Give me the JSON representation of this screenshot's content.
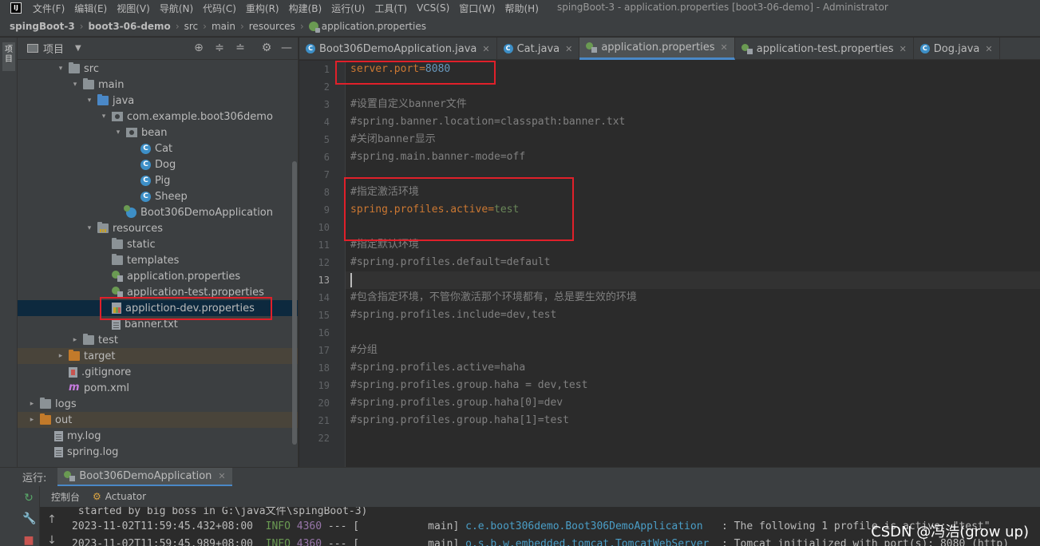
{
  "menu": {
    "logo": "IJ",
    "items": [
      "文件(F)",
      "编辑(E)",
      "视图(V)",
      "导航(N)",
      "代码(C)",
      "重构(R)",
      "构建(B)",
      "运行(U)",
      "工具(T)",
      "VCS(S)",
      "窗口(W)",
      "帮助(H)"
    ],
    "window_title": "spingBoot-3 - application.properties [boot3-06-demo] - Administrator"
  },
  "breadcrumb": [
    "spingBoot-3",
    "boot3-06-demo",
    "src",
    "main",
    "resources",
    "application.properties"
  ],
  "left_stripe": {
    "project_label": "项目"
  },
  "project_panel": {
    "title": "项目",
    "tools": [
      "⊕",
      "≑",
      "≐",
      "⚙",
      "—"
    ]
  },
  "tree": [
    {
      "label": "src",
      "indent": 3,
      "arrow": "▾",
      "icon": "folder"
    },
    {
      "label": "main",
      "indent": 4,
      "arrow": "▾",
      "icon": "folder"
    },
    {
      "label": "java",
      "indent": 5,
      "arrow": "▾",
      "icon": "folder blue"
    },
    {
      "label": "com.example.boot306demo",
      "indent": 6,
      "arrow": "▾",
      "icon": "package"
    },
    {
      "label": "bean",
      "indent": 7,
      "arrow": "▾",
      "icon": "package"
    },
    {
      "label": "Cat",
      "indent": 8,
      "arrow": "",
      "icon": "cls"
    },
    {
      "label": "Dog",
      "indent": 8,
      "arrow": "",
      "icon": "cls"
    },
    {
      "label": "Pig",
      "indent": 8,
      "arrow": "",
      "icon": "cls"
    },
    {
      "label": "Sheep",
      "indent": 8,
      "arrow": "",
      "icon": "cls"
    },
    {
      "label": "Boot306DemoApplication",
      "indent": 7,
      "arrow": "",
      "icon": "spring-cls"
    },
    {
      "label": "resources",
      "indent": 5,
      "arrow": "▾",
      "icon": "folder res"
    },
    {
      "label": "static",
      "indent": 6,
      "arrow": "",
      "icon": "folder"
    },
    {
      "label": "templates",
      "indent": 6,
      "arrow": "",
      "icon": "folder"
    },
    {
      "label": "application.properties",
      "indent": 6,
      "arrow": "",
      "icon": "props"
    },
    {
      "label": "application-test.properties",
      "indent": 6,
      "arrow": "",
      "icon": "props"
    },
    {
      "label": "appliction-dev.properties",
      "indent": 6,
      "arrow": "",
      "icon": "props-dev",
      "selected": true
    },
    {
      "label": "banner.txt",
      "indent": 6,
      "arrow": "",
      "icon": "file"
    },
    {
      "label": "test",
      "indent": 4,
      "arrow": "▸",
      "icon": "folder"
    },
    {
      "label": "target",
      "indent": 3,
      "arrow": "▸",
      "icon": "folder orange",
      "highlight": true
    },
    {
      "label": ".gitignore",
      "indent": 3,
      "arrow": "",
      "icon": "gitignore"
    },
    {
      "label": "pom.xml",
      "indent": 3,
      "arrow": "",
      "icon": "maven"
    },
    {
      "label": "logs",
      "indent": 1,
      "arrow": "▸",
      "icon": "folder"
    },
    {
      "label": "out",
      "indent": 1,
      "arrow": "▸",
      "icon": "folder orange",
      "highlight": true
    },
    {
      "label": "my.log",
      "indent": 2,
      "arrow": "",
      "icon": "file"
    },
    {
      "label": "spring.log",
      "indent": 2,
      "arrow": "",
      "icon": "file"
    }
  ],
  "editor_tabs": [
    {
      "label": "Boot306DemoApplication.java",
      "icon": "c",
      "active": false
    },
    {
      "label": "Cat.java",
      "icon": "c",
      "active": false
    },
    {
      "label": "application.properties",
      "icon": "props",
      "active": true
    },
    {
      "label": "application-test.properties",
      "icon": "props",
      "active": false
    },
    {
      "label": "Dog.java",
      "icon": "c",
      "active": false
    }
  ],
  "editor": {
    "current_line": 13,
    "lines": [
      {
        "n": 1,
        "key": "server.port",
        "value": "8080",
        "num": true
      },
      {
        "n": 2
      },
      {
        "n": 3,
        "comment": "#设置自定义banner文件"
      },
      {
        "n": 4,
        "comment": "#spring.banner.location=classpath:banner.txt"
      },
      {
        "n": 5,
        "comment": "#关闭banner显示"
      },
      {
        "n": 6,
        "comment": "#spring.main.banner-mode=off"
      },
      {
        "n": 7
      },
      {
        "n": 8,
        "comment": "#指定激活环境"
      },
      {
        "n": 9,
        "key": "spring.profiles.active",
        "value": "test"
      },
      {
        "n": 10
      },
      {
        "n": 11,
        "comment": "#指定默认环境"
      },
      {
        "n": 12,
        "comment": "#spring.profiles.default=default"
      },
      {
        "n": 13
      },
      {
        "n": 14,
        "comment": "#包含指定环境，不管你激活那个环境都有，总是要生效的环境"
      },
      {
        "n": 15,
        "comment": "#spring.profiles.include=dev,test"
      },
      {
        "n": 16
      },
      {
        "n": 17,
        "comment": "#分组"
      },
      {
        "n": 18,
        "comment": "#spring.profiles.active=haha"
      },
      {
        "n": 19,
        "comment": "#spring.profiles.group.haha = dev,test"
      },
      {
        "n": 20,
        "comment": "#spring.profiles.group.haha[0]=dev"
      },
      {
        "n": 21,
        "comment": "#spring.profiles.group.haha[1]=test"
      },
      {
        "n": 22
      }
    ]
  },
  "run_panel": {
    "label": "运行:",
    "tab": "Boot306DemoApplication",
    "sub_tabs": [
      "控制台",
      "Actuator"
    ],
    "console": {
      "line0": " started by big boss in G:\\java文件\\spingBoot-3)",
      "line1": {
        "ts": "2023-11-02T11:59:45.432+08:00",
        "level": "INFO",
        "pid": "4360",
        "sep": "---",
        "bracket": "[",
        "thread": "main]",
        "logger": "c.e.boot306demo.Boot306DemoApplication",
        "msg": ": The following 1 profile is active: \"test\""
      },
      "line2": {
        "ts": "2023-11-02T11:59:45.989+08:00",
        "level": "INFO",
        "pid": "4360",
        "sep": "---",
        "bracket": "[",
        "thread": "main]",
        "logger": "o.s.b.w.embedded.tomcat.TomcatWebServer",
        "msg": ": Tomcat initialized with port(s): 8080 (http)"
      }
    }
  },
  "watermark": "CSDN @冯浩(grow up)"
}
